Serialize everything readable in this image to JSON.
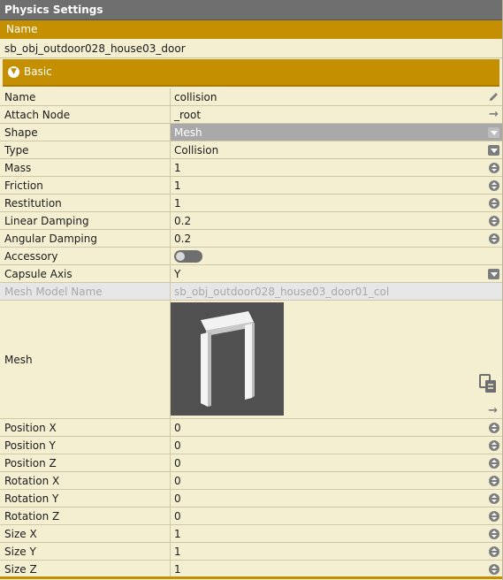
{
  "panel": {
    "title": "Physics Settings"
  },
  "name_section": {
    "header": "Name",
    "value": "sb_obj_outdoor028_house03_door"
  },
  "basic_section": {
    "label": "Basic",
    "icon": "chevron-down-circle-icon"
  },
  "properties": [
    {
      "key": "name",
      "label": "Name",
      "value": "collision",
      "control": "edit"
    },
    {
      "key": "attach-node",
      "label": "Attach Node",
      "value": "_root",
      "control": "arrow"
    },
    {
      "key": "shape",
      "label": "Shape",
      "value": "Mesh",
      "control": "dropdown",
      "state": "selected"
    },
    {
      "key": "type",
      "label": "Type",
      "value": "Collision",
      "control": "dropdown"
    },
    {
      "key": "mass",
      "label": "Mass",
      "value": "1",
      "control": "spinner"
    },
    {
      "key": "friction",
      "label": "Friction",
      "value": "1",
      "control": "spinner"
    },
    {
      "key": "restitution",
      "label": "Restitution",
      "value": "1",
      "control": "spinner"
    },
    {
      "key": "linear-damping",
      "label": "Linear Damping",
      "value": "0.2",
      "control": "spinner"
    },
    {
      "key": "angular-damping",
      "label": "Angular Damping",
      "value": "0.2",
      "control": "spinner"
    },
    {
      "key": "accessory",
      "label": "Accessory",
      "value": "",
      "control": "toggle",
      "checked": false
    },
    {
      "key": "capsule-axis",
      "label": "Capsule Axis",
      "value": "Y",
      "control": "dropdown"
    },
    {
      "key": "mesh-model-name",
      "label": "Mesh Model Name",
      "value": "sb_obj_outdoor028_house03_door01_col",
      "control": "none",
      "state": "disabled"
    }
  ],
  "mesh": {
    "label": "Mesh"
  },
  "transform": [
    {
      "key": "position-x",
      "label": "Position X",
      "value": "0"
    },
    {
      "key": "position-y",
      "label": "Position Y",
      "value": "0"
    },
    {
      "key": "position-z",
      "label": "Position Z",
      "value": "0"
    },
    {
      "key": "rotation-x",
      "label": "Rotation X",
      "value": "0"
    },
    {
      "key": "rotation-y",
      "label": "Rotation Y",
      "value": "0"
    },
    {
      "key": "rotation-z",
      "label": "Rotation Z",
      "value": "0"
    },
    {
      "key": "size-x",
      "label": "Size X",
      "value": "1"
    },
    {
      "key": "size-y",
      "label": "Size Y",
      "value": "1"
    },
    {
      "key": "size-z",
      "label": "Size Z",
      "value": "1"
    }
  ],
  "colors": {
    "accent": "#c48f00",
    "background": "#f5efd2",
    "titlebar": "#6f6f6f",
    "selected": "#a9a9a9"
  }
}
